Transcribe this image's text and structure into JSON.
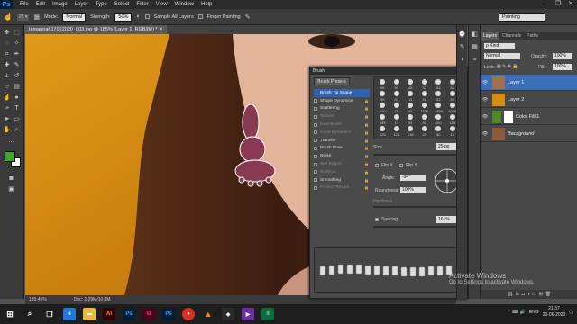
{
  "app": {
    "logo": "Ps",
    "menu": [
      "File",
      "Edit",
      "Image",
      "Layer",
      "Type",
      "Select",
      "Filter",
      "View",
      "Window",
      "Help"
    ],
    "window_controls": [
      "–",
      "❐",
      "✕"
    ]
  },
  "options": {
    "mode_label": "Mode:",
    "mode_value": "Normal",
    "strength_label": "Strength:",
    "strength_value": "50%",
    "sample_all_layers": "Sample All Layers",
    "finger_painting": "Finger Painting",
    "workspace": "Painting"
  },
  "document": {
    "tab_title": "tamannah17022020_003.jpg @ 185% (Layer 1, RGB/8#) *",
    "zoom": "185.45%",
    "doc_size": "Doc: 2.29M/10.3M"
  },
  "brush_panel": {
    "title": "Brush",
    "presets_button": "Brush Presets",
    "options": [
      {
        "label": "Brush Tip Shape",
        "checked": null,
        "selected": true,
        "dim": false
      },
      {
        "label": "Shape Dynamics",
        "checked": false,
        "selected": false,
        "dim": false
      },
      {
        "label": "Scattering",
        "checked": false,
        "selected": false,
        "dim": false
      },
      {
        "label": "Texture",
        "checked": false,
        "selected": false,
        "dim": true
      },
      {
        "label": "Dual Brush",
        "checked": false,
        "selected": false,
        "dim": true
      },
      {
        "label": "Color Dynamics",
        "checked": false,
        "selected": false,
        "dim": true
      },
      {
        "label": "Transfer",
        "checked": false,
        "selected": false,
        "dim": false
      },
      {
        "label": "Brush Pose",
        "checked": false,
        "selected": false,
        "dim": false
      },
      {
        "label": "Noise",
        "checked": false,
        "selected": false,
        "dim": false
      },
      {
        "label": "Wet Edges",
        "checked": false,
        "selected": false,
        "dim": true
      },
      {
        "label": "Build-up",
        "checked": false,
        "selected": false,
        "dim": true
      },
      {
        "label": "Smoothing",
        "checked": true,
        "selected": false,
        "dim": false
      },
      {
        "label": "Protect Texture",
        "checked": false,
        "selected": false,
        "dim": true
      }
    ],
    "tip_sizes": [
      "96",
      "90",
      "36",
      "33",
      "63",
      "66",
      "39",
      "63",
      "11",
      "48",
      "32",
      "55",
      "100",
      "75",
      "45",
      "1106",
      "1499",
      "1006",
      "145",
      "14",
      "54",
      "81",
      "100",
      "155",
      "125",
      "123",
      "218",
      "25",
      "30",
      "16"
    ],
    "size_label": "Size",
    "size_value": "25 px",
    "flip_x": "Flip X",
    "flip_y": "Flip Y",
    "angle_label": "Angle:",
    "angle_value": "-94°",
    "roundness_label": "Roundness:",
    "roundness_value": "100%",
    "hardness_label": "Hardness",
    "spacing_label": "Spacing",
    "spacing_value": "161%"
  },
  "layers_panel": {
    "tabs": [
      "Layers",
      "Channels",
      "Paths"
    ],
    "kind": "ρ Kind",
    "blend_mode": "Normal",
    "opacity_label": "Opacity:",
    "opacity_value": "100%",
    "lock_label": "Lock:",
    "fill_label": "Fill:",
    "fill_value": "100%",
    "layers": [
      {
        "name": "Layer 1",
        "selected": true,
        "thumb": "#a0724c"
      },
      {
        "name": "Layer 2",
        "selected": false,
        "thumb": "#d98a11"
      },
      {
        "name": "Color Fill 1",
        "selected": false,
        "thumb": "#4c8a2a"
      },
      {
        "name": "Background",
        "selected": false,
        "thumb": "#8c5a3c"
      }
    ]
  },
  "watermark": {
    "line1": "Activate Windows",
    "line2": "Go to Settings to activate Windows."
  },
  "taskbar": {
    "time": "21:37",
    "date": "20-06-2020",
    "lang": "ENG",
    "icons": [
      "AI",
      "Ps",
      "Id",
      "Ps"
    ]
  },
  "colors": {
    "accent": "#2f63ad",
    "canvas_bg": "#d98a11",
    "selected_layer": "#3a6fb8",
    "fg_color": "#3aa820",
    "bg_color": "#ffffff"
  }
}
